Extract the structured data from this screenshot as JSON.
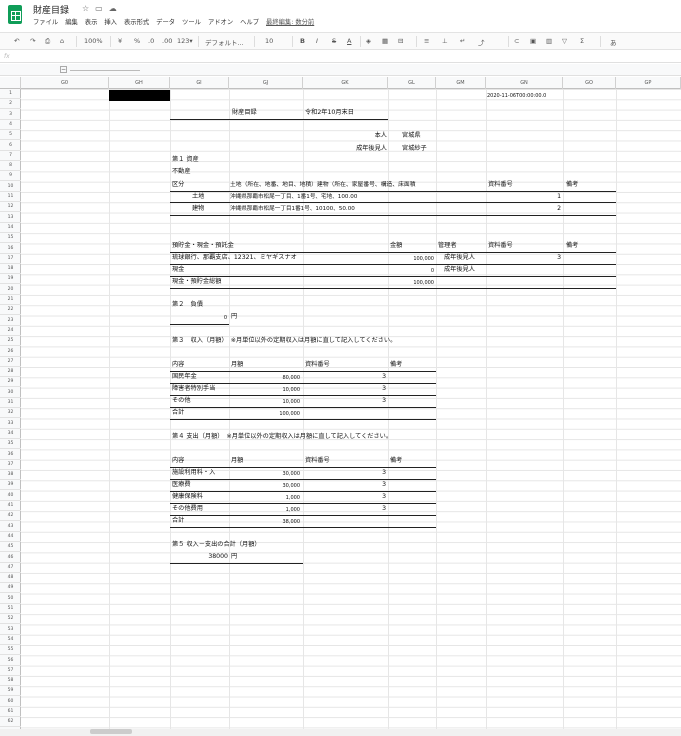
{
  "app": {
    "title": "財産目録",
    "menu": [
      "ファイル",
      "編集",
      "表示",
      "挿入",
      "表示形式",
      "データ",
      "ツール",
      "アドオン",
      "ヘルプ"
    ],
    "last_edit": "最終編集: 数分前"
  },
  "toolbar": {
    "zoom": "100%",
    "currency": "¥",
    "percent": "%",
    "dec1": ".0",
    "dec2": ".00",
    "format": "123▾",
    "font": "デフォルト...",
    "size": "10",
    "bold": "B",
    "italic": "I",
    "strike": "S",
    "textcolor": "A"
  },
  "formula": {
    "fx": "fx"
  },
  "columns": [
    "G0",
    "GH",
    "GI",
    "GJ",
    "GK",
    "GL",
    "GM",
    "GN",
    "GO",
    "GP"
  ],
  "rows": [
    "1",
    "2",
    "3",
    "4",
    "5",
    "6",
    "7",
    "8",
    "9",
    "10",
    "11",
    "12",
    "13",
    "14",
    "15",
    "16",
    "17",
    "18",
    "19",
    "20",
    "21",
    "22",
    "23",
    "24",
    "25",
    "26",
    "27",
    "28",
    "29",
    "30",
    "31",
    "32",
    "33",
    "34",
    "35",
    "36",
    "37",
    "38",
    "39",
    "40",
    "41",
    "42",
    "43",
    "44",
    "45",
    "46",
    "47",
    "48",
    "49",
    "50",
    "51",
    "52",
    "53",
    "54",
    "55",
    "56",
    "57",
    "58",
    "59",
    "60",
    "61",
    "62"
  ],
  "sheet": {
    "datetime": "2020-11-06T00:00:00.0",
    "doc_title": "財産目録",
    "date": "令和2年10月末日",
    "person_label": "本人",
    "person_name": "宮城県",
    "guardian_label": "成年後見人",
    "guardian_name": "宮城紗子",
    "sec1": "第１ 資産",
    "sec1_sub": "不動産",
    "re_hdr": [
      "区分",
      "土地（所在、地番、地目、地積）建物（所在、家屋番号、構造、床面積",
      "資料番号",
      "備考"
    ],
    "re_rows": [
      {
        "kind": "土地",
        "desc": "沖縄県那覇市松尾一丁目、1番1号、宅地、100.00",
        "no": "1"
      },
      {
        "kind": "建物",
        "desc": "沖縄県那覇市松尾一丁目1番1号、10100、50.00",
        "no": "2"
      }
    ],
    "dep_hdr": [
      "預貯金・現金・預託金",
      "金額",
      "管理者",
      "資料番号",
      "備考"
    ],
    "dep_rows": [
      {
        "name": "琉球銀行、那覇支店、12321、ミヤギスナオ",
        "amount": "100,000",
        "mgr": "成年後見人",
        "no": "3"
      },
      {
        "name": "現金",
        "amount": "0",
        "mgr": "成年後見人",
        "no": ""
      },
      {
        "name": "現金・預貯金総額",
        "amount": "100,000",
        "mgr": "",
        "no": ""
      }
    ],
    "sec2": "第２　負債",
    "debt_amount": "0",
    "debt_unit": "円",
    "sec3": "第３　収入（月額）　※月単位以外の定期収入は月額に直して記入してください。",
    "inc_hdr": [
      "内容",
      "月額",
      "資料番号",
      "備考"
    ],
    "inc_rows": [
      {
        "item": "国民年金",
        "amount": "80,000",
        "no": "3"
      },
      {
        "item": "障害者特別手当",
        "amount": "10,000",
        "no": "3"
      },
      {
        "item": "その他",
        "amount": "10,000",
        "no": "3"
      },
      {
        "item": "合計",
        "amount": "100,000",
        "no": ""
      }
    ],
    "sec4": "第４ 支出（月額）　※月単位以外の定期収入は月額に直して記入してください。",
    "exp_hdr": [
      "内容",
      "月額",
      "資料番号",
      "備考"
    ],
    "exp_rows": [
      {
        "item": "施設利用料・入",
        "amount": "30,000",
        "no": "3"
      },
      {
        "item": "医療費",
        "amount": "30,000",
        "no": "3"
      },
      {
        "item": "健康保険料",
        "amount": "1,000",
        "no": "3"
      },
      {
        "item": "その他費用",
        "amount": "1,000",
        "no": "3"
      },
      {
        "item": "合計",
        "amount": "38,000",
        "no": ""
      }
    ],
    "sec5": "第５ 収入－支出の合計（月額）",
    "net_amount": "38000",
    "net_unit": "円"
  }
}
